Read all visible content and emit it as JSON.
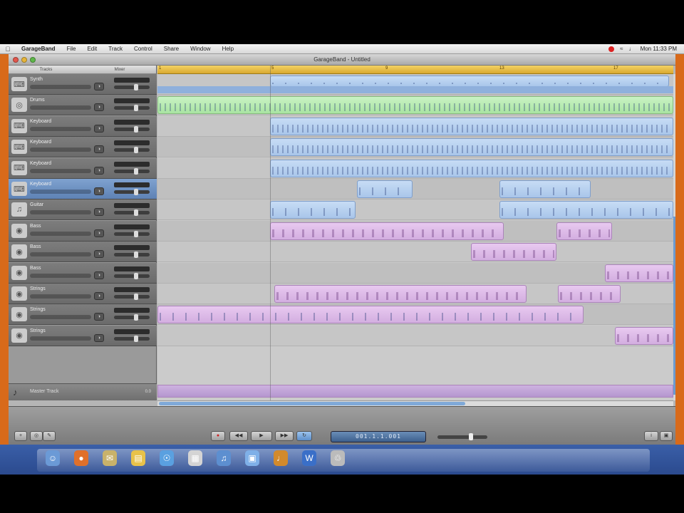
{
  "menubar": {
    "app": "GarageBand",
    "items": [
      "File",
      "Edit",
      "Track",
      "Control",
      "Share",
      "Window",
      "Help"
    ],
    "clock": "Mon 11:33 PM"
  },
  "window": {
    "title": "GarageBand - Untitled",
    "column_header": [
      "Tracks",
      "Mixer"
    ]
  },
  "tracks": [
    {
      "name": "Synth",
      "icon": "keyboard-icon",
      "selected": false
    },
    {
      "name": "Drums",
      "icon": "drums-icon",
      "selected": false
    },
    {
      "name": "Keyboard",
      "icon": "keyboard-icon",
      "selected": false
    },
    {
      "name": "Keyboard",
      "icon": "keyboard-icon",
      "selected": false
    },
    {
      "name": "Keyboard",
      "icon": "keyboard-icon",
      "selected": false
    },
    {
      "name": "Keyboard",
      "icon": "keyboard-icon",
      "selected": true
    },
    {
      "name": "Guitar",
      "icon": "guitar-icon",
      "selected": false
    },
    {
      "name": "Bass",
      "icon": "speaker-icon",
      "selected": false
    },
    {
      "name": "Bass",
      "icon": "speaker-icon",
      "selected": false
    },
    {
      "name": "Bass",
      "icon": "speaker-icon",
      "selected": false
    },
    {
      "name": "Strings",
      "icon": "speaker-icon",
      "selected": false
    },
    {
      "name": "Strings",
      "icon": "speaker-icon",
      "selected": false
    },
    {
      "name": "Strings",
      "icon": "speaker-icon",
      "selected": false
    }
  ],
  "master_track": {
    "name": "Master Track",
    "value": "0.0"
  },
  "ruler": {
    "bars": [
      "1",
      "5",
      "9",
      "13",
      "17"
    ]
  },
  "transport": {
    "lcd": "001.1.1.001",
    "buttons": [
      "record",
      "rewind",
      "play",
      "forward",
      "cycle"
    ]
  },
  "dock": {
    "icons": [
      "finder-icon",
      "firefox-icon",
      "mail-icon",
      "folder-icon",
      "safari-icon",
      "ical-icon",
      "itunes-icon",
      "iphoto-icon",
      "garageband-icon",
      "word-icon",
      "trash-icon"
    ]
  },
  "colors": {
    "frame": "#d86a1a",
    "ruler": "#e8bf4a",
    "region_blue": "#b7d0ef",
    "region_green": "#b6eaae",
    "region_purple": "#dcb9e6"
  }
}
